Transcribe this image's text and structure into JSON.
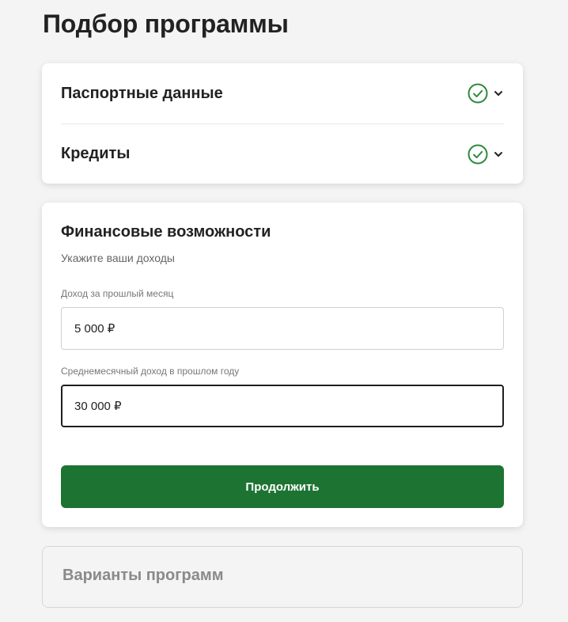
{
  "page": {
    "title": "Подбор программы"
  },
  "completed_steps": [
    {
      "title": "Паспортные данные",
      "status_icon": "check-circle-icon",
      "toggle_icon": "chevron-down-icon"
    },
    {
      "title": "Кредиты",
      "status_icon": "check-circle-icon",
      "toggle_icon": "chevron-down-icon"
    }
  ],
  "financial": {
    "title": "Финансовые возможности",
    "subtitle": "Укажите ваши доходы",
    "fields": [
      {
        "label": "Доход за прошлый месяц",
        "value": "5 000 ₽"
      },
      {
        "label": "Среднемесячный доход в прошлом году",
        "value": "30 000 ₽"
      }
    ],
    "continue_label": "Продолжить"
  },
  "pending_step": {
    "title": "Варианты программ"
  },
  "colors": {
    "accent_green": "#1d7432",
    "check_green": "#2e8b3e",
    "background": "#f4f4f4"
  }
}
